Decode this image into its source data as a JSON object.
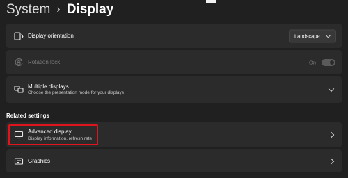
{
  "header": {
    "parent": "System",
    "separator": "›",
    "current": "Display"
  },
  "settings": {
    "orientation": {
      "title": "Display orientation",
      "icon": "display-orientation-icon",
      "selected_option": "Landscape"
    },
    "rotation_lock": {
      "title": "Rotation lock",
      "icon": "rotation-lock-icon",
      "state_label": "On",
      "enabled": false
    },
    "multiple_displays": {
      "title": "Multiple displays",
      "subtitle": "Choose the presentation mode for your displays",
      "icon": "multiple-displays-icon"
    }
  },
  "related": {
    "heading": "Related settings",
    "advanced_display": {
      "title": "Advanced display",
      "subtitle": "Display information, refresh rate",
      "icon": "monitor-icon"
    },
    "graphics": {
      "title": "Graphics",
      "icon": "graphics-icon"
    }
  },
  "colors": {
    "background": "#202020",
    "card": "#2b2b2b",
    "highlight": "#e0141c"
  }
}
